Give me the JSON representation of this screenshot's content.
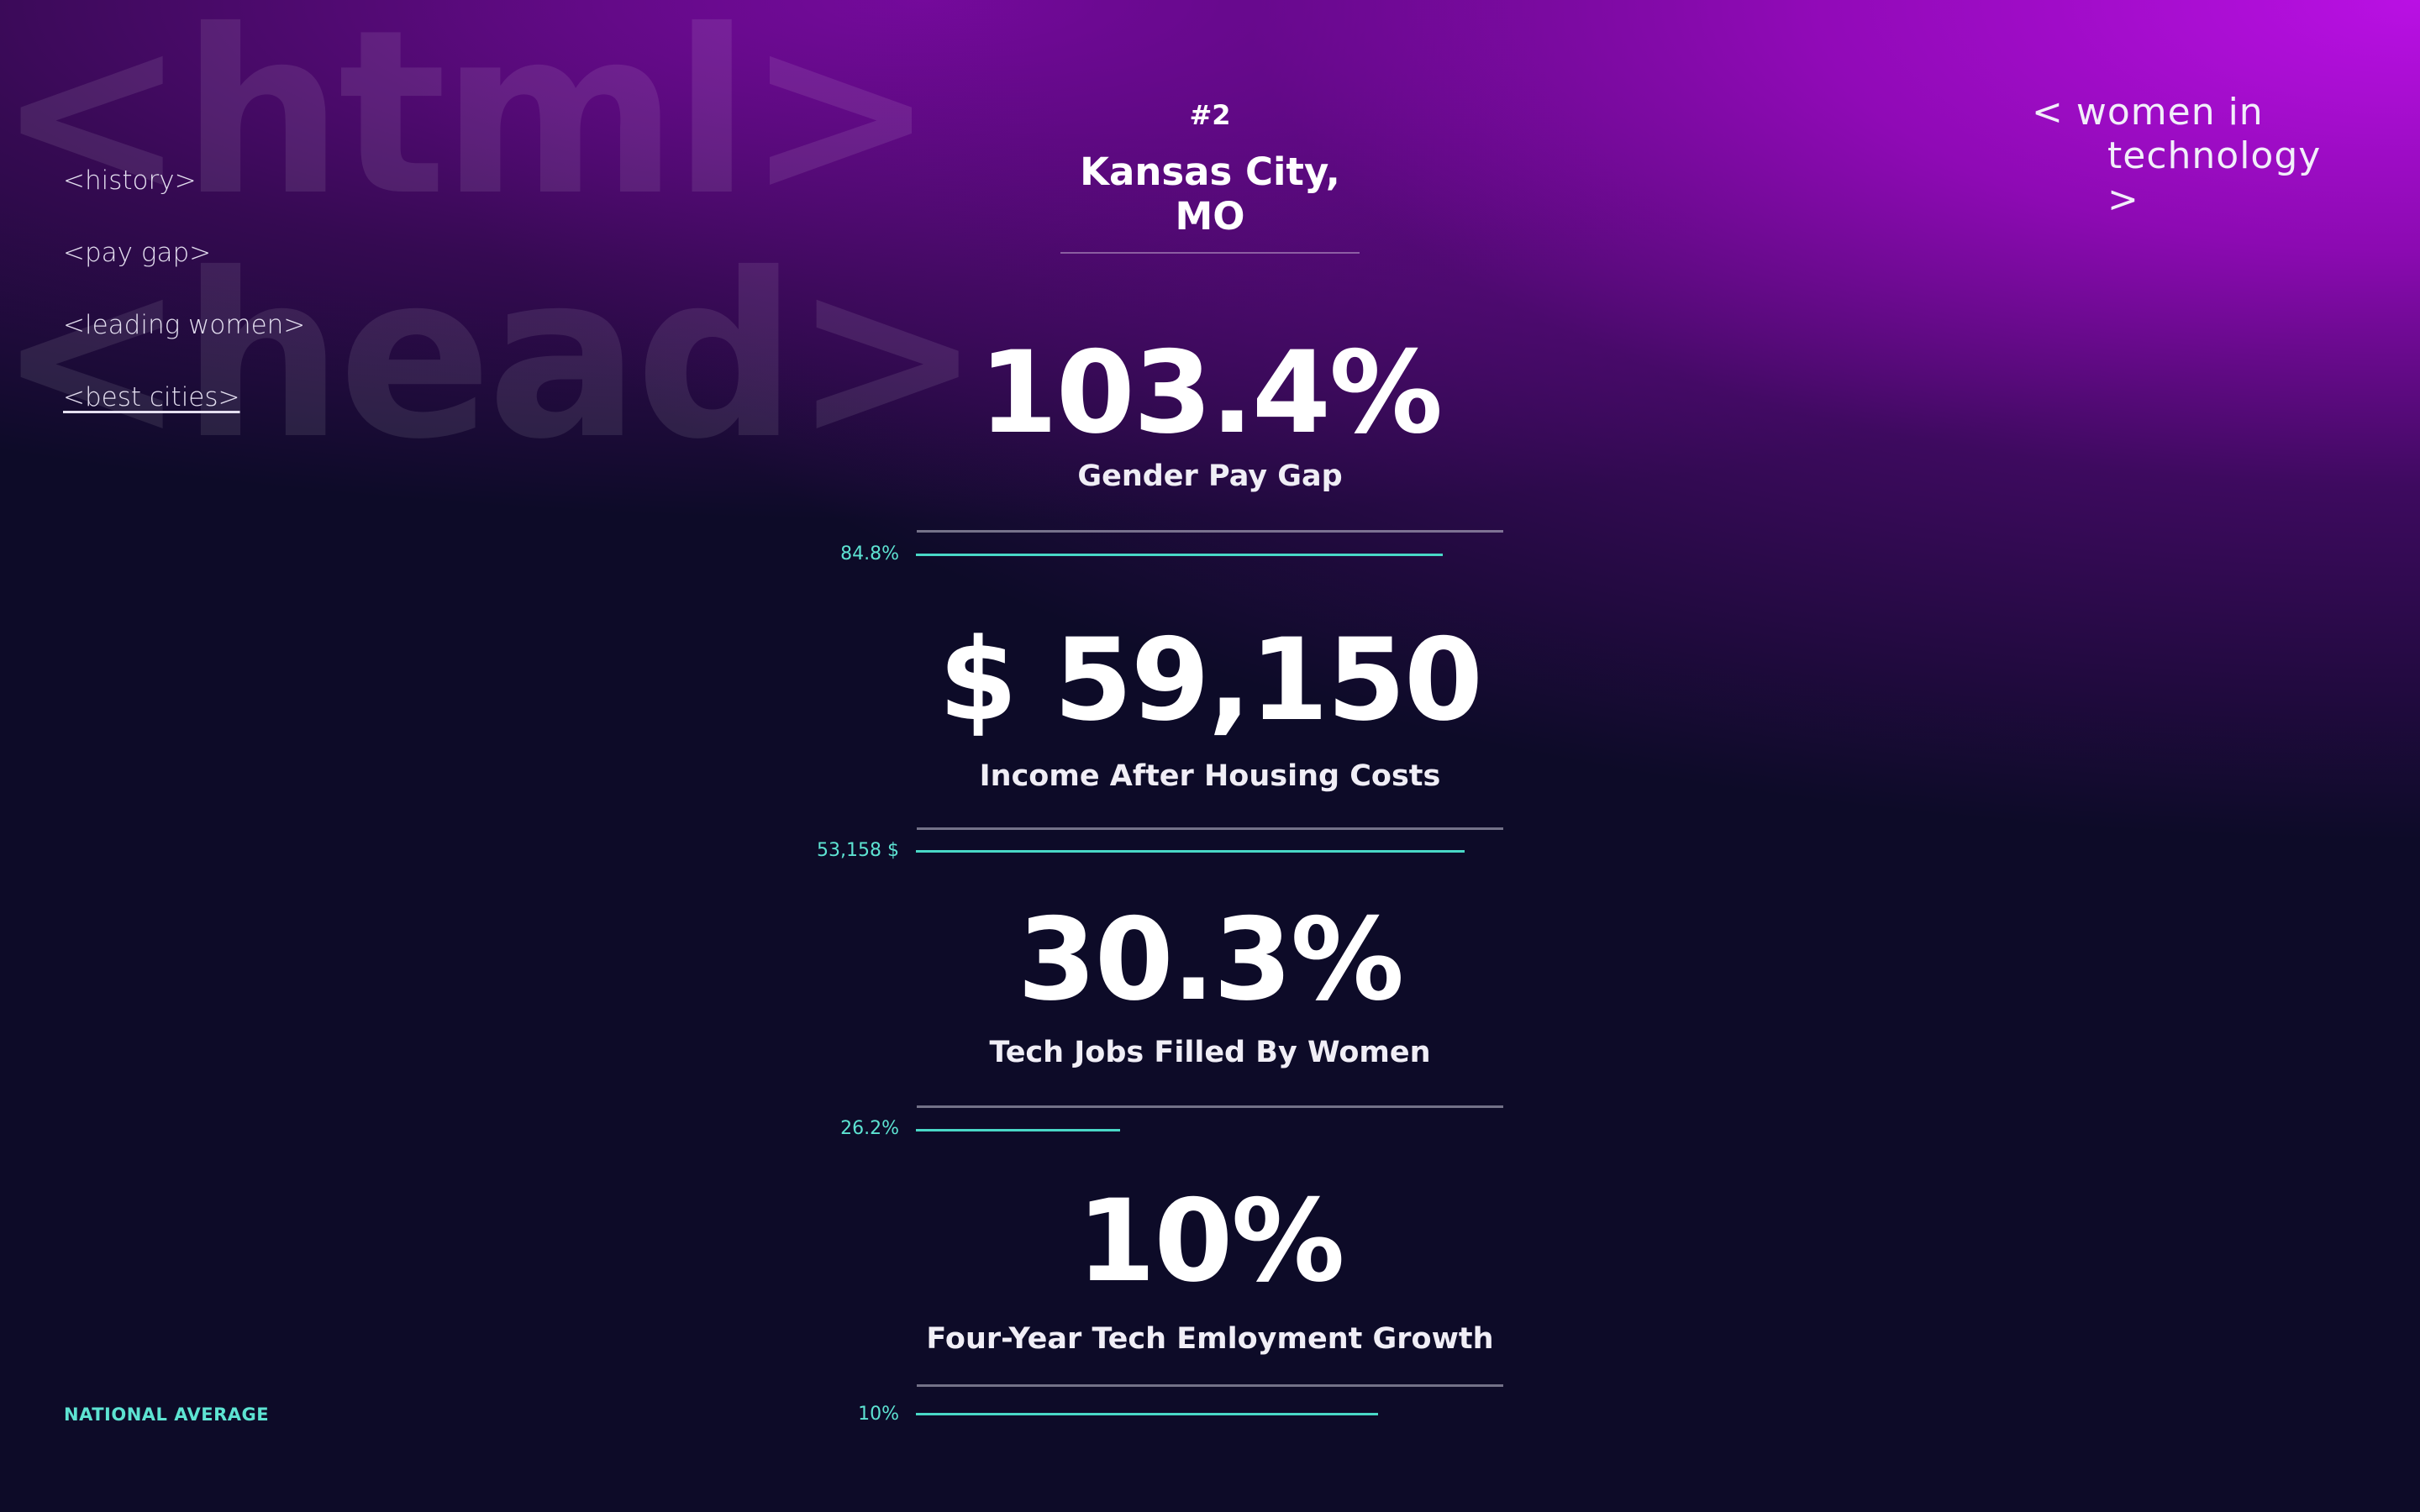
{
  "watermark": {
    "line1": "<html>",
    "line2": "<head>"
  },
  "nav": {
    "items": [
      {
        "label": "<history>",
        "active": false
      },
      {
        "label": "<pay gap>",
        "active": false
      },
      {
        "label": "<leading women>",
        "active": false
      },
      {
        "label": "<best cities>",
        "active": true
      }
    ]
  },
  "brand": {
    "line1": "< women in",
    "line2": "technology >"
  },
  "city": {
    "rank": "#2",
    "name": "Kansas City, MO"
  },
  "stats": [
    {
      "value": "103.4%",
      "label": "Gender Pay Gap",
      "national_label": "84.8%",
      "national_fraction": 0.49
    },
    {
      "value": "$ 59,150",
      "label": "Income After Housing Costs",
      "national_label": "53,158 $",
      "national_fraction": 0.51
    },
    {
      "value": "30.3%",
      "label": "Tech Jobs Filled By Women",
      "national_label": "26.2%",
      "national_fraction": 0.19
    },
    {
      "value": "10%",
      "label": "Four-Year Tech Emloyment Growth",
      "national_label": "10%",
      "national_fraction": 0.43
    }
  ],
  "legend": {
    "label": "NATIONAL AVERAGE"
  },
  "colors": {
    "accent": "#49d8c7",
    "background": "#0d0b28",
    "gradient": "#b010d8"
  }
}
